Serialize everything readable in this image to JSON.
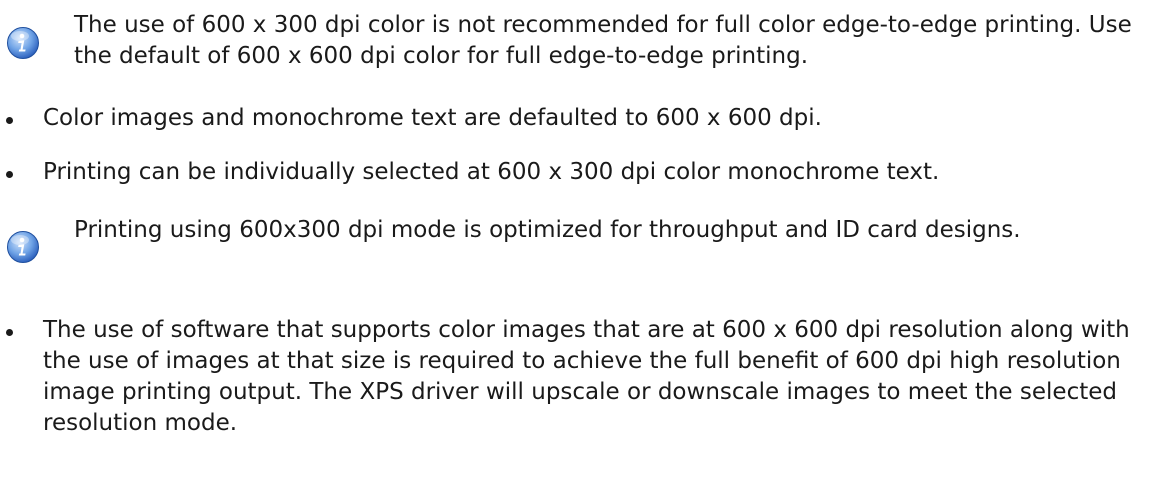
{
  "notes": [
    {
      "icon": "info-icon",
      "text": "The use of 600 x 300 dpi color is not recommended for full color edge-to-edge printing. Use the default of 600 x 600 dpi color for full edge-to-edge printing."
    },
    {
      "icon": "info-icon",
      "text": "Printing using 600x300 dpi mode is optimized for throughput and ID card designs."
    }
  ],
  "bullets": [
    "Color images and monochrome text are defaulted to 600 x 600 dpi.",
    "Printing can be individually selected at 600 x 300 dpi color monochrome text.",
    "The use of software that supports color images that are at 600 x 600 dpi resolution along with the use of images at that size is required to achieve the full benefit of 600 dpi high resolution image printing output. The XPS driver will upscale or downscale images to meet the selected resolution mode."
  ],
  "colors": {
    "text": "#1a1a1a",
    "icon_blue": "#2f6fd0",
    "icon_light": "#a9c8f2"
  }
}
